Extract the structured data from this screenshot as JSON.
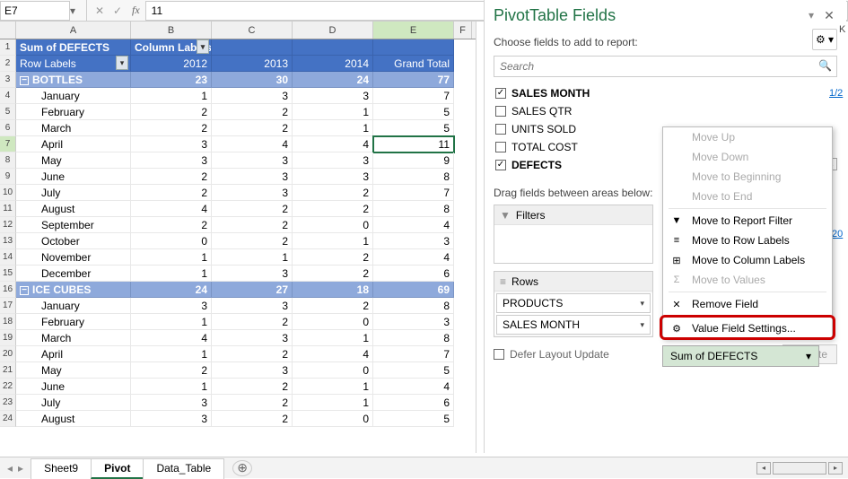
{
  "formula_bar": {
    "cell_ref": "E7",
    "value": "11"
  },
  "columns": [
    "A",
    "B",
    "C",
    "D",
    "E",
    "F"
  ],
  "pivot": {
    "title_cell": "Sum of DEFECTS",
    "col_labels_text": "Column Labels",
    "row_labels_text": "Row Labels",
    "years": [
      "2012",
      "2013",
      "2014"
    ],
    "grand": "Grand Total",
    "groups": [
      {
        "name": "BOTTLES",
        "totals": [
          23,
          30,
          24,
          77
        ],
        "rows": [
          {
            "m": "January",
            "v": [
              1,
              3,
              3,
              7
            ]
          },
          {
            "m": "February",
            "v": [
              2,
              2,
              1,
              5
            ]
          },
          {
            "m": "March",
            "v": [
              2,
              2,
              1,
              5
            ]
          },
          {
            "m": "April",
            "v": [
              3,
              4,
              4,
              11
            ]
          },
          {
            "m": "May",
            "v": [
              3,
              3,
              3,
              9
            ]
          },
          {
            "m": "June",
            "v": [
              2,
              3,
              3,
              8
            ]
          },
          {
            "m": "July",
            "v": [
              2,
              3,
              2,
              7
            ]
          },
          {
            "m": "August",
            "v": [
              4,
              2,
              2,
              8
            ]
          },
          {
            "m": "September",
            "v": [
              2,
              2,
              0,
              4
            ]
          },
          {
            "m": "October",
            "v": [
              0,
              2,
              1,
              3
            ]
          },
          {
            "m": "November",
            "v": [
              1,
              1,
              2,
              4
            ]
          },
          {
            "m": "December",
            "v": [
              1,
              3,
              2,
              6
            ]
          }
        ]
      },
      {
        "name": "ICE CUBES",
        "totals": [
          24,
          27,
          18,
          69
        ],
        "rows": [
          {
            "m": "January",
            "v": [
              3,
              3,
              2,
              8
            ]
          },
          {
            "m": "February",
            "v": [
              1,
              2,
              0,
              3
            ]
          },
          {
            "m": "March",
            "v": [
              4,
              3,
              1,
              8
            ]
          },
          {
            "m": "April",
            "v": [
              1,
              2,
              4,
              7
            ]
          },
          {
            "m": "May",
            "v": [
              2,
              3,
              0,
              5
            ]
          },
          {
            "m": "June",
            "v": [
              1,
              2,
              1,
              4
            ]
          },
          {
            "m": "July",
            "v": [
              3,
              2,
              1,
              6
            ]
          },
          {
            "m": "August",
            "v": [
              3,
              2,
              0,
              5
            ]
          }
        ]
      }
    ],
    "selected": {
      "row_index": 7,
      "col": "E"
    }
  },
  "row_numbers_start": 1,
  "pane": {
    "title": "PivotTable Fields",
    "subtitle": "Choose fields to add to report:",
    "search_placeholder": "Search",
    "fields": [
      {
        "label": "SALES MONTH",
        "checked": true,
        "bold": true
      },
      {
        "label": "SALES QTR",
        "checked": false,
        "bold": false
      },
      {
        "label": "UNITS SOLD",
        "checked": false,
        "bold": false
      },
      {
        "label": "TOTAL COST",
        "checked": false,
        "bold": false
      },
      {
        "label": "DEFECTS",
        "checked": true,
        "bold": true
      }
    ],
    "drag_label": "Drag fields between areas below:",
    "filters_label": "Filters",
    "rows_label": "Rows",
    "rows_tags": [
      "PRODUCTS",
      "SALES MONTH"
    ],
    "sigma_tag": "Sum of DEFECTS",
    "defer_label": "Defer Layout Update",
    "update_label": "Update"
  },
  "ctx": {
    "items": [
      {
        "label": "Move Up",
        "enabled": false,
        "icon": ""
      },
      {
        "label": "Move Down",
        "enabled": false,
        "icon": ""
      },
      {
        "label": "Move to Beginning",
        "enabled": false,
        "icon": ""
      },
      {
        "label": "Move to End",
        "enabled": false,
        "icon": ""
      },
      {
        "label": "Move to Report Filter",
        "enabled": true,
        "icon": "▼"
      },
      {
        "label": "Move to Row Labels",
        "enabled": true,
        "icon": "≡"
      },
      {
        "label": "Move to Column Labels",
        "enabled": true,
        "icon": "⊞"
      },
      {
        "label": "Move to Values",
        "enabled": false,
        "icon": "Σ"
      },
      {
        "label": "Remove Field",
        "enabled": true,
        "icon": "✕"
      },
      {
        "label": "Value Field Settings...",
        "enabled": true,
        "icon": "⚙"
      }
    ],
    "highlight_index": 9
  },
  "tabs": {
    "sheets": [
      "Sheet9",
      "Pivot",
      "Data_Table"
    ],
    "active": 1
  }
}
